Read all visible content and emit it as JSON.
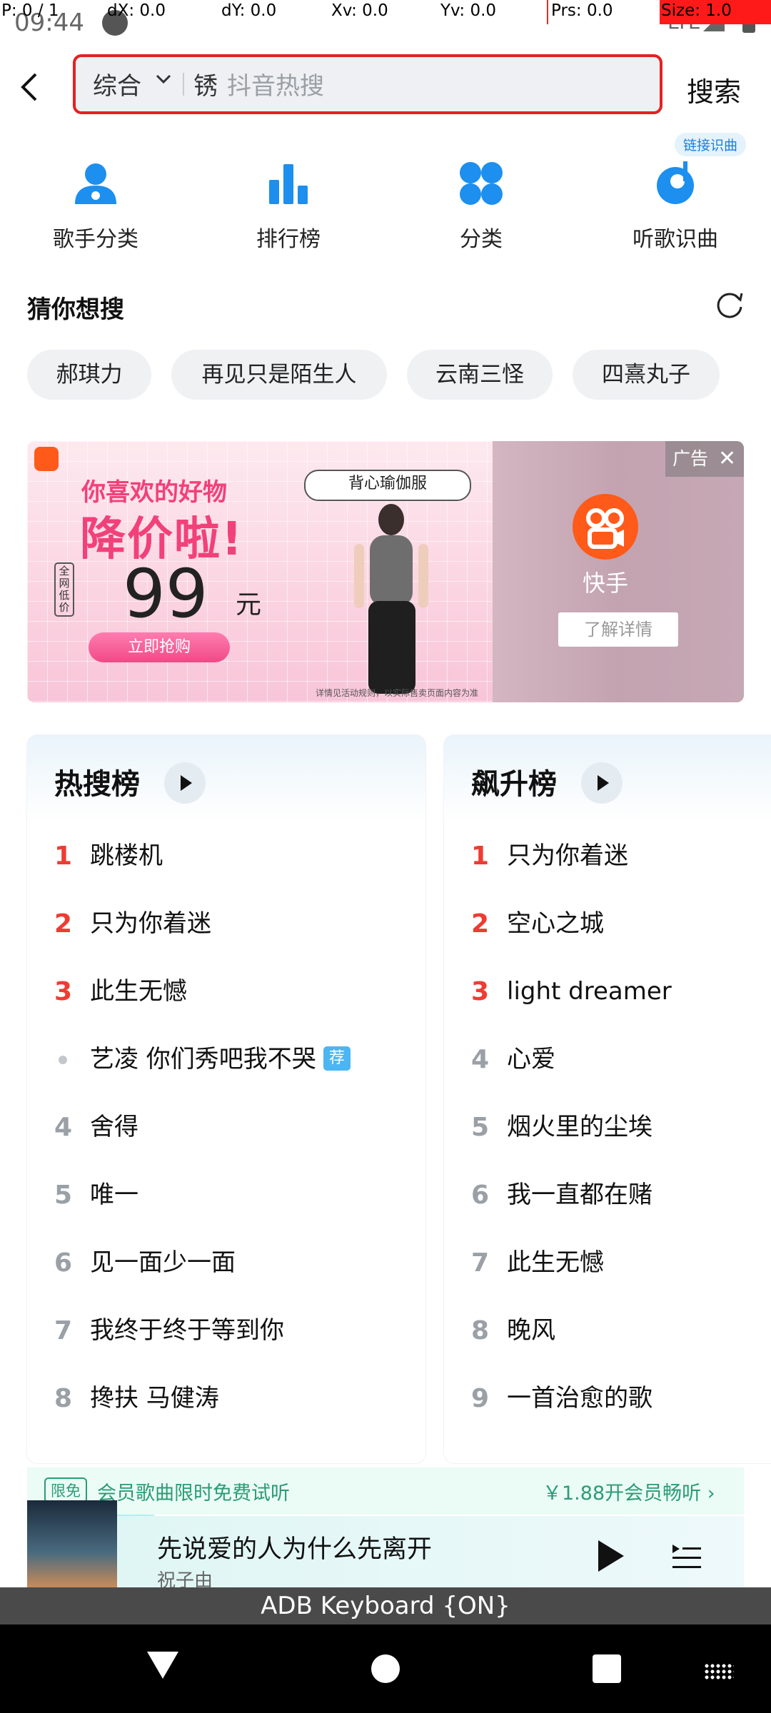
{
  "pointer_overlay": {
    "p": "P: 0 / 1",
    "dx": "dX: 0.0",
    "dy": "dY: 0.0",
    "xv": "Xv: 0.0",
    "yv": "Yv: 0.0",
    "prs": "Prs: 0.0",
    "size": "Size: 1.0"
  },
  "status_bar": {
    "time": "09:44",
    "network": "LTE"
  },
  "search": {
    "category": "综合",
    "query_char": "锈",
    "placeholder": "抖音热搜",
    "button": "搜索"
  },
  "quick_entries": [
    {
      "label": "歌手分类",
      "icon": "singer-icon"
    },
    {
      "label": "排行榜",
      "icon": "chart-bars-icon"
    },
    {
      "label": "分类",
      "icon": "category-icon"
    },
    {
      "label": "听歌识曲",
      "icon": "recognize-song-icon"
    }
  ],
  "link_recognize_tag": "链接识曲",
  "guess": {
    "title": "猜你想搜",
    "chips": [
      "郝琪力",
      "再见只是陌生人",
      "云南三怪",
      "四熹丸子"
    ]
  },
  "ad": {
    "headline1": "你喜欢的好物",
    "headline2": "降价啦!",
    "badge": "全网低价",
    "price": "99",
    "unit": "元",
    "cta": "立即抢购",
    "product": "背心瑜伽服",
    "footnote": "详情见活动规则，以实际售卖页面内容为准",
    "tag": "广告",
    "brand": "快手",
    "more": "了解详情",
    "colors": {
      "pink": "#f2417a",
      "brand": "#ff5a1a"
    }
  },
  "hot_chart": {
    "title": "热搜榜",
    "items": [
      {
        "rank": "1",
        "title": "跳楼机"
      },
      {
        "rank": "2",
        "title": "只为你着迷"
      },
      {
        "rank": "3",
        "title": "此生无憾"
      },
      {
        "rank": "",
        "title": "艺凌 你们秀吧我不哭",
        "badge": "荐"
      },
      {
        "rank": "4",
        "title": "舍得"
      },
      {
        "rank": "5",
        "title": "唯一"
      },
      {
        "rank": "6",
        "title": "见一面少一面"
      },
      {
        "rank": "7",
        "title": "我终于终于等到你"
      },
      {
        "rank": "8",
        "title": "搀扶 马健涛"
      }
    ]
  },
  "rise_chart": {
    "title": "飙升榜",
    "items": [
      {
        "rank": "1",
        "title": "只为你着迷"
      },
      {
        "rank": "2",
        "title": "空心之城"
      },
      {
        "rank": "3",
        "title": "light dreamer"
      },
      {
        "rank": "4",
        "title": "心爱"
      },
      {
        "rank": "5",
        "title": "烟火里的尘埃"
      },
      {
        "rank": "6",
        "title": "我一直都在赌"
      },
      {
        "rank": "7",
        "title": "此生无憾"
      },
      {
        "rank": "8",
        "title": "晚风"
      },
      {
        "rank": "9",
        "title": "一首治愈的歌"
      }
    ]
  },
  "vip": {
    "tag": "限免",
    "text": "会员歌曲限时免费试听",
    "right": "￥1.88开会员畅听 ›"
  },
  "player": {
    "title": "先说爱的人为什么先离开",
    "artist": "祝子由"
  },
  "adb_bar": "ADB Keyboard {ON}"
}
